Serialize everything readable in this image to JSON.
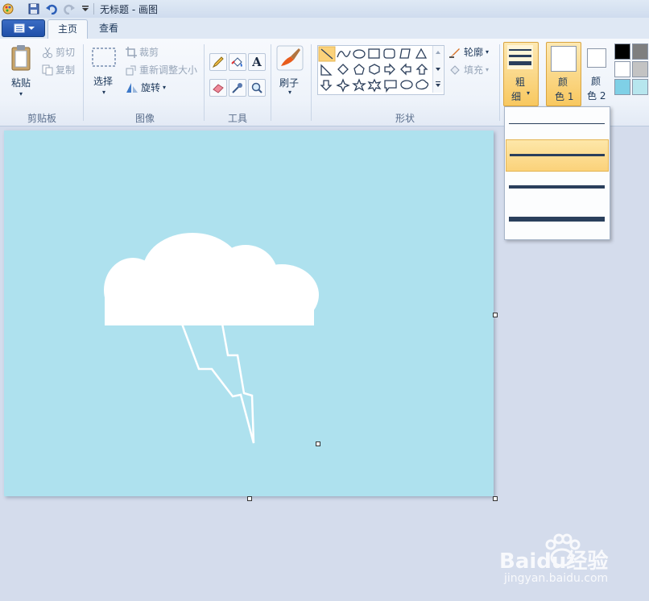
{
  "window": {
    "title": "无标题 - 画图"
  },
  "tabs": [
    {
      "label": "主页"
    },
    {
      "label": "查看"
    }
  ],
  "ribbon": {
    "clipboard": {
      "group_label": "剪贴板",
      "paste": "粘贴",
      "cut": "剪切",
      "copy": "复制"
    },
    "image": {
      "group_label": "图像",
      "select": "选择",
      "crop": "裁剪",
      "resize": "重新调整大小",
      "rotate": "旋转"
    },
    "tools": {
      "group_label": "工具"
    },
    "brushes": {
      "label": "刷子"
    },
    "shapes": {
      "group_label": "形状",
      "outline": "轮廓",
      "fill": "填充"
    },
    "size": {
      "label_top": "粗",
      "label_bottom": "细"
    },
    "color1": {
      "label_top": "颜",
      "label_bottom": "色 1"
    },
    "color2": {
      "label_top": "颜",
      "label_bottom": "色 2"
    },
    "palette": [
      "#000000",
      "#7f7f7f",
      "#ffffff",
      "#c3c3c3",
      "#7fd0e6",
      "#b7e6ee"
    ]
  },
  "size_dropdown": {
    "options": [
      "1px",
      "3px",
      "5px",
      "8px"
    ],
    "selected_index": 1
  },
  "colors": {
    "canvas_bg": "#aee1ee",
    "accent": "#fbd27a"
  },
  "watermark": {
    "brand": "Baidu经验",
    "url": "jingyan.baidu.com"
  }
}
